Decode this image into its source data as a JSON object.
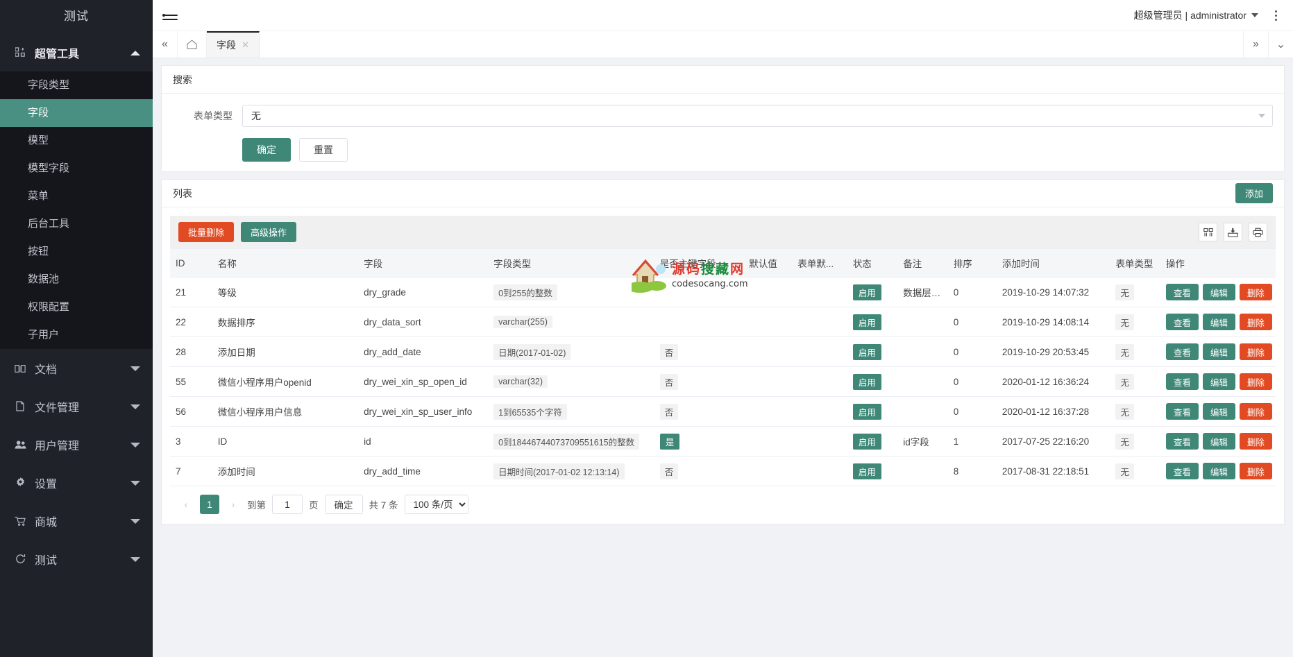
{
  "sidebar": {
    "brand": "测试",
    "groups": [
      {
        "label": "超管工具",
        "icon": "apps-icon",
        "expanded": true,
        "arrow": "up",
        "items": [
          {
            "label": "字段类型",
            "active": false
          },
          {
            "label": "字段",
            "active": true
          },
          {
            "label": "模型",
            "active": false
          },
          {
            "label": "模型字段",
            "active": false
          },
          {
            "label": "菜单",
            "active": false
          },
          {
            "label": "后台工具",
            "active": false
          },
          {
            "label": "按钮",
            "active": false
          },
          {
            "label": "数据池",
            "active": false
          },
          {
            "label": "权限配置",
            "active": false
          },
          {
            "label": "子用户",
            "active": false
          }
        ]
      },
      {
        "label": "文档",
        "icon": "book-icon",
        "expanded": false,
        "arrow": "down",
        "items": []
      },
      {
        "label": "文件管理",
        "icon": "file-icon",
        "expanded": false,
        "arrow": "down",
        "items": []
      },
      {
        "label": "用户管理",
        "icon": "users-icon",
        "expanded": false,
        "arrow": "down",
        "items": []
      },
      {
        "label": "设置",
        "icon": "gear-icon",
        "expanded": false,
        "arrow": "down",
        "items": []
      },
      {
        "label": "商城",
        "icon": "cart-icon",
        "expanded": false,
        "arrow": "down",
        "items": []
      },
      {
        "label": "测试",
        "icon": "refresh-icon",
        "expanded": false,
        "arrow": "down",
        "items": []
      }
    ]
  },
  "topbar": {
    "menu_toggle_icon": "hamburger-icon",
    "user": "超级管理员 | administrator",
    "more_icon": "kebab-menu-icon"
  },
  "tabbar": {
    "collapse_left_icon": "double-chevron-left-icon",
    "home_icon": "home-icon",
    "tabs": [
      {
        "label": "字段",
        "closable": true,
        "active": true
      }
    ],
    "scroll_right_icon": "double-chevron-right-icon",
    "dropdown_icon": "chevron-down-icon"
  },
  "search": {
    "title": "搜索",
    "field_label": "表单类型",
    "field_value": "无",
    "submit_label": "确定",
    "reset_label": "重置"
  },
  "list": {
    "title": "列表",
    "add_label": "添加",
    "batch_delete_label": "批量删除",
    "advanced_label": "高级操作",
    "tool_icons": [
      "columns-icon",
      "export-icon",
      "print-icon"
    ],
    "columns": [
      "ID",
      "名称",
      "字段",
      "字段类型",
      "是否主键字段",
      "默认值",
      "表单默...",
      "状态",
      "备注",
      "排序",
      "添加时间",
      "表单类型",
      "操作"
    ],
    "rows": [
      {
        "id": "21",
        "name": "等级",
        "field": "dry_grade",
        "type": "0到255的整数",
        "pk": "",
        "default": "",
        "form_default": "",
        "status": "启用",
        "remark": "数据层…",
        "sort": "0",
        "add_time": "2019-10-29 14:07:32",
        "form_type": "无"
      },
      {
        "id": "22",
        "name": "数据排序",
        "field": "dry_data_sort",
        "type": "varchar(255)",
        "pk": "",
        "default": "",
        "form_default": "",
        "status": "启用",
        "remark": "",
        "sort": "0",
        "add_time": "2019-10-29 14:08:14",
        "form_type": "无"
      },
      {
        "id": "28",
        "name": "添加日期",
        "field": "dry_add_date",
        "type": "日期(2017-01-02)",
        "pk": "否",
        "default": "",
        "form_default": "",
        "status": "启用",
        "remark": "",
        "sort": "0",
        "add_time": "2019-10-29 20:53:45",
        "form_type": "无"
      },
      {
        "id": "55",
        "name": "微信小程序用户openid",
        "field": "dry_wei_xin_sp_open_id",
        "type": "varchar(32)",
        "pk": "否",
        "default": "",
        "form_default": "",
        "status": "启用",
        "remark": "",
        "sort": "0",
        "add_time": "2020-01-12 16:36:24",
        "form_type": "无"
      },
      {
        "id": "56",
        "name": "微信小程序用户信息",
        "field": "dry_wei_xin_sp_user_info",
        "type": "1到65535个字符",
        "pk": "否",
        "default": "",
        "form_default": "",
        "status": "启用",
        "remark": "",
        "sort": "0",
        "add_time": "2020-01-12 16:37:28",
        "form_type": "无"
      },
      {
        "id": "3",
        "name": "ID",
        "field": "id",
        "type": "0到18446744073709551615的整数",
        "pk": "是",
        "default": "",
        "form_default": "",
        "status": "启用",
        "remark": "id字段",
        "sort": "1",
        "add_time": "2017-07-25 22:16:20",
        "form_type": "无"
      },
      {
        "id": "7",
        "name": "添加时间",
        "field": "dry_add_time",
        "type": "日期时间(2017-01-02 12:13:14)",
        "pk": "否",
        "default": "",
        "form_default": "",
        "status": "启用",
        "remark": "",
        "sort": "8",
        "add_time": "2017-08-31 22:18:51",
        "form_type": "无"
      }
    ],
    "row_actions": {
      "view": "查看",
      "edit": "编辑",
      "delete": "删除"
    }
  },
  "pager": {
    "prev_icon": "chevron-left-icon",
    "next_icon": "chevron-right-icon",
    "current_page": "1",
    "goto_prefix": "到第",
    "goto_value": "1",
    "goto_suffix": "页",
    "confirm_label": "确定",
    "total_text": "共 7 条",
    "page_size": "100 条/页"
  },
  "watermark": {
    "line1": "源码搜藏网",
    "line2": "codesocang.com"
  },
  "colors": {
    "accent_teal": "#3f8878",
    "active_teal": "#4a9082",
    "danger": "#e14a22",
    "sidebar_bg": "#20222a",
    "sidebar_sub_bg": "#15161c"
  }
}
